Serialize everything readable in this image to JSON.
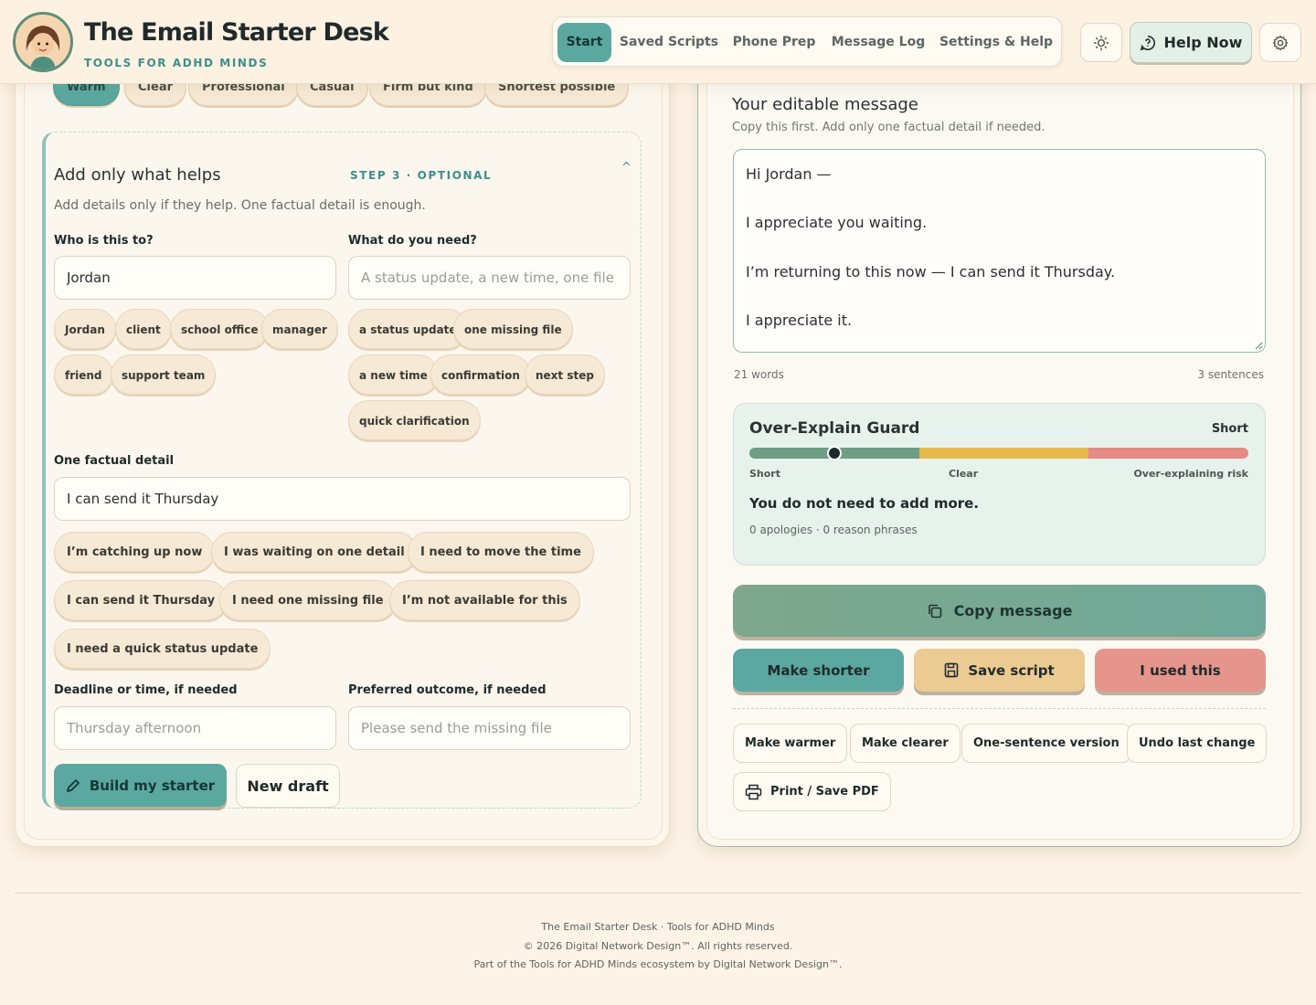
{
  "app": {
    "title": "The Email Starter Desk",
    "subtitle": "TOOLS FOR ADHD MINDS"
  },
  "nav": {
    "items": [
      {
        "label": "Start",
        "active": true
      },
      {
        "label": "Saved Scripts",
        "active": false
      },
      {
        "label": "Phone Prep",
        "active": false
      },
      {
        "label": "Message Log",
        "active": false
      },
      {
        "label": "Settings & Help",
        "active": false
      }
    ],
    "help_now": "Help Now",
    "icons": [
      "sun-icon",
      "help-bubble-icon",
      "gear-icon"
    ]
  },
  "tone": {
    "chips": [
      {
        "label": "Warm",
        "active": true
      },
      {
        "label": "Clear",
        "active": false
      },
      {
        "label": "Professional",
        "active": false
      },
      {
        "label": "Casual",
        "active": false
      },
      {
        "label": "Firm but kind",
        "active": false
      },
      {
        "label": "Shortest possible",
        "active": false
      }
    ]
  },
  "details": {
    "title": "Add only what helps",
    "step": "STEP 3 · OPTIONAL",
    "caret": "^",
    "description": "Add details only if they help. One factual detail is enough.",
    "who": {
      "label": "Who is this to?",
      "value": "Jordan",
      "placeholder": "",
      "chips": [
        "Jordan",
        "client",
        "school office",
        "manager",
        "friend",
        "support team"
      ]
    },
    "need": {
      "label": "What do you need?",
      "value": "",
      "placeholder": "A status update, a new time, one file",
      "chips": [
        "a status update",
        "one missing file",
        "a new time",
        "confirmation",
        "next step",
        "quick clarification"
      ]
    },
    "detail": {
      "label": "One factual detail",
      "value": "I can send it Thursday",
      "placeholder": "",
      "chips": [
        "I’m catching up now",
        "I was waiting on one detail",
        "I need to move the time",
        "I can send it Thursday",
        "I need one missing file",
        "I’m not available for this",
        "I need a quick status update"
      ]
    },
    "deadline": {
      "label": "Deadline or time, if needed",
      "value": "",
      "placeholder": "Thursday afternoon"
    },
    "outcome": {
      "label": "Preferred outcome, if needed",
      "value": "",
      "placeholder": "Please send the missing file"
    },
    "build_label": "Build my starter",
    "new_draft_label": "New draft"
  },
  "message": {
    "title": "Your editable message",
    "subtitle": "Copy this first. Add only one factual detail if needed.",
    "lines": [
      "Hi Jordan —",
      "",
      "I appreciate you waiting.",
      "",
      "I’m returning to this now — I can send it Thursday.",
      "",
      "I appreciate it."
    ],
    "word_count": "21 words",
    "sentence_count": "3 sentences"
  },
  "guard": {
    "title": "Over-Explain Guard",
    "level": "Short",
    "meter_value": 0.17,
    "meter_colors": [
      "#6f9e84",
      "#e5b94c",
      "#e48b86"
    ],
    "scale_labels": [
      "Short",
      "Clear",
      "Over-explaining risk"
    ],
    "message": "You do not need to add more.",
    "stats": "0 apologies · 0 reason phrases"
  },
  "actions": {
    "copy": "Copy message",
    "make_shorter": "Make shorter",
    "save_script": "Save script",
    "used_this": "I used this",
    "secondary": [
      "Make warmer",
      "Make clearer",
      "One-sentence version",
      "Undo last change"
    ],
    "print": "Print / Save PDF",
    "colors": {
      "shorter": "#5aa8a0",
      "save": "#ebcb92",
      "used": "#e6958c"
    }
  },
  "footer": {
    "line1": "The Email Starter Desk · Tools for ADHD Minds",
    "line2": "© 2026 Digital Network Design™. All rights reserved.",
    "line3": "Part of the Tools for ADHD Minds ecosystem by Digital Network Design™."
  }
}
